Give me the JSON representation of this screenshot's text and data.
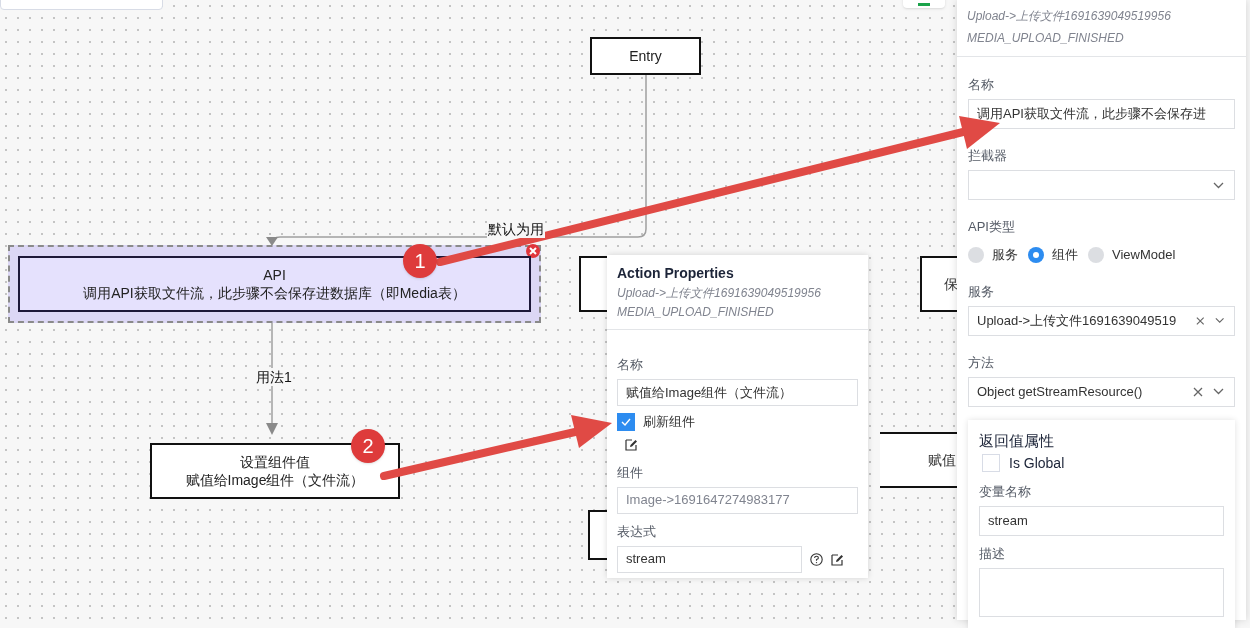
{
  "nodes": [
    {
      "kind": "entry",
      "lines": [
        "Entry"
      ],
      "selected": false
    },
    {
      "kind": "action",
      "lines": [
        "API",
        "调用API获取文件流，此步骤不会保存进数据库（即Media表）"
      ],
      "selected": true
    },
    {
      "kind": "action",
      "lines": [
        "设置组件值",
        "赋值给Image组件（文件流）"
      ],
      "selected": false
    }
  ],
  "partial_nodes": [
    {
      "text": "保"
    },
    {
      "text": "赋值"
    }
  ],
  "edges": [
    {
      "label": "默认为用"
    },
    {
      "label": "用法1"
    }
  ],
  "annotations": [
    {
      "number": "1"
    },
    {
      "number": "2"
    }
  ],
  "inline_panel": {
    "title": "Action Properties",
    "source": "Upload->上传文件1691639049519956",
    "event": "MEDIA_UPLOAD_FINISHED",
    "fields": [
      {
        "kind": "text",
        "label": "名称",
        "value": "赋值给Image组件（文件流）",
        "disabled": false
      },
      {
        "kind": "checkbox",
        "label": "刷新组件",
        "checked": true
      },
      {
        "kind": "edit"
      },
      {
        "kind": "text",
        "label": "组件",
        "value": "Image->1691647274983177",
        "disabled": true
      },
      {
        "kind": "expression",
        "label": "表达式",
        "value": "stream"
      }
    ]
  },
  "side_panel": {
    "source": "Upload->上传文件1691639049519956",
    "event": "MEDIA_UPLOAD_FINISHED",
    "fields": [
      {
        "kind": "text",
        "label": "名称",
        "value": "调用API获取文件流，此步骤不会保存进",
        "disabled": false
      },
      {
        "kind": "select",
        "label": "拦截器",
        "clearable": false
      },
      {
        "kind": "radio",
        "label": "API类型",
        "options": [
          {
            "label": "服务",
            "selected": false
          },
          {
            "label": "组件",
            "selected": true
          },
          {
            "label": "ViewModel",
            "selected": false
          }
        ]
      },
      {
        "kind": "select",
        "label": "服务",
        "value": "Upload->上传文件1691639049519",
        "clearable": true
      },
      {
        "kind": "select",
        "label": "方法",
        "value": "Object getStreamResource()",
        "clearable": true
      }
    ],
    "return_section": {
      "title": "返回值属性",
      "is_global": {
        "label": "Is Global",
        "checked": false
      },
      "fields": [
        {
          "kind": "text",
          "label": "变量名称",
          "value": "stream",
          "disabled": false
        },
        {
          "kind": "textarea",
          "label": "描述"
        }
      ]
    }
  }
}
